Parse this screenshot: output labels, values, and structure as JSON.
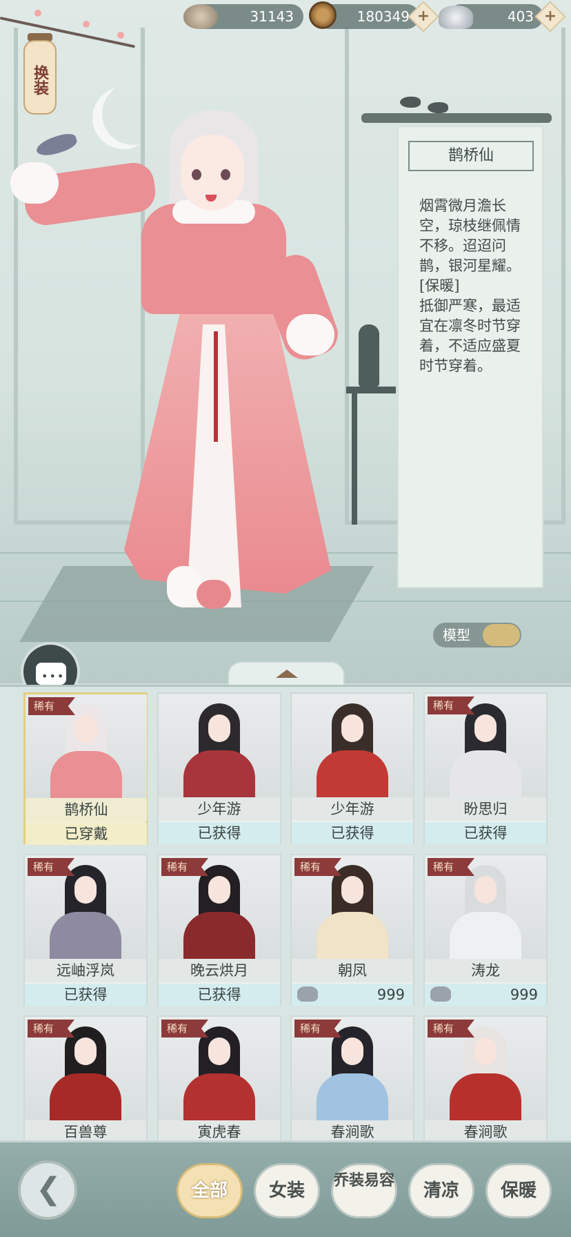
{
  "resources": {
    "shells": "31143",
    "coins": "180349",
    "silver": "403",
    "plus_symbol": "+"
  },
  "header": {
    "lantern_label": "换装"
  },
  "outfit_detail": {
    "name": "鹊桥仙",
    "description": "烟霄微月澹长空，琼枝继佩情不移。迢迢问鹊，银河星耀。\n[保暖]\n抵御严寒，最适宜在凛冬时节穿着，不适应盛夏时节穿着。",
    "model_toggle_label": "模型"
  },
  "outfits": [
    {
      "name": "鹊桥仙",
      "status": "已穿戴",
      "rare": true,
      "price": null,
      "selected": true,
      "hair": "#ece6e8",
      "body": "#ea8f93"
    },
    {
      "name": "少年游",
      "status": "已获得",
      "rare": false,
      "price": null,
      "selected": false,
      "hair": "#2d2a2e",
      "body": "#a8353b"
    },
    {
      "name": "少年游",
      "status": "已获得",
      "rare": false,
      "price": null,
      "selected": false,
      "hair": "#3a2e2a",
      "body": "#c23a35"
    },
    {
      "name": "盼思归",
      "status": "已获得",
      "rare": true,
      "price": null,
      "selected": false,
      "hair": "#2a2a30",
      "body": "#e6e6ea"
    },
    {
      "name": "远岫浮岚",
      "status": "已获得",
      "rare": true,
      "price": null,
      "selected": false,
      "hair": "#26242b",
      "body": "#8e8aa0"
    },
    {
      "name": "晚云烘月",
      "status": "已获得",
      "rare": true,
      "price": null,
      "selected": false,
      "hair": "#231f22",
      "body": "#8a2a2c"
    },
    {
      "name": "朝凤",
      "status": "",
      "rare": true,
      "price": "999",
      "selected": false,
      "hair": "#3b2c28",
      "body": "#f1e3c8"
    },
    {
      "name": "涛龙",
      "status": "",
      "rare": true,
      "price": "999",
      "selected": false,
      "hair": "#d9dcdd",
      "body": "#eef0f2"
    },
    {
      "name": "百兽尊",
      "status": "",
      "rare": true,
      "price": null,
      "selected": false,
      "hair": "#211e1f",
      "body": "#a82a26"
    },
    {
      "name": "寅虎春",
      "status": "",
      "rare": true,
      "price": null,
      "selected": false,
      "hair": "#222025",
      "body": "#b3312f"
    },
    {
      "name": "春涧歌",
      "status": "",
      "rare": true,
      "price": null,
      "selected": false,
      "hair": "#25242a",
      "body": "#9fc3e0"
    },
    {
      "name": "春涧歌",
      "status": "",
      "rare": true,
      "price": null,
      "selected": false,
      "hair": "#e7e4e2",
      "body": "#b8302c"
    }
  ],
  "rare_label": "稀有",
  "filters": [
    {
      "label": "全部",
      "active": true
    },
    {
      "label": "女装",
      "active": false
    },
    {
      "label": "乔装易容",
      "active": false
    },
    {
      "label": "清凉",
      "active": false
    },
    {
      "label": "保暖",
      "active": false
    }
  ],
  "colors": {
    "accent_gold": "#d4bb7b",
    "rare_tag": "#8c3a3a",
    "outfit_pink": "#ea8f93"
  }
}
